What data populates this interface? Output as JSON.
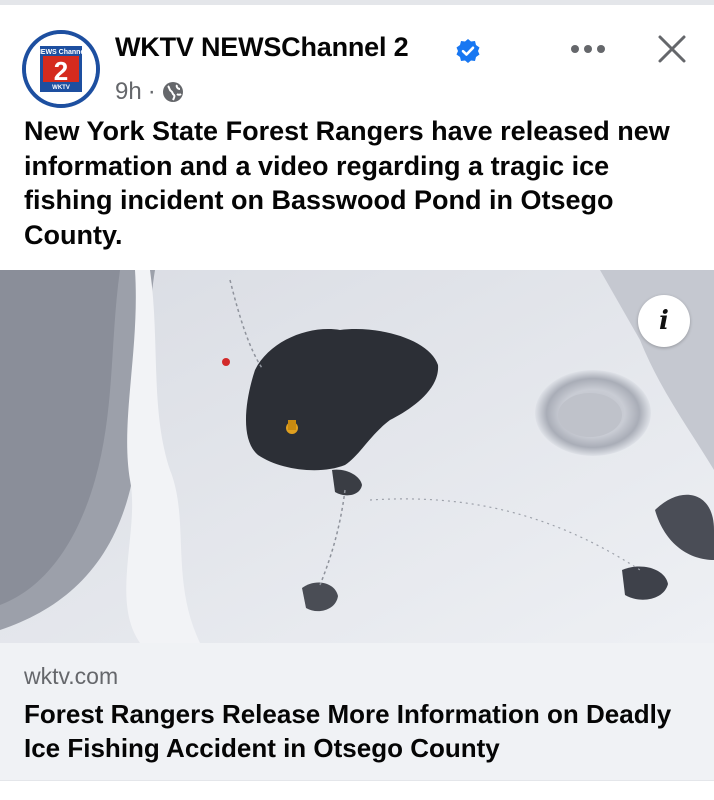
{
  "post": {
    "page_name": "WKTV NEWSChannel 2",
    "verified_icon": "verified-badge-icon",
    "time_ago": "9h",
    "separator": "·",
    "audience_icon": "globe-icon",
    "text": "New York State Forest Rangers have released new information and a video regarding a tragic ice fishing incident on Basswood Pond in Otsego County."
  },
  "logo": {
    "top_text": "NEWS Channel",
    "numeral": "2",
    "bottom_text": "WKTV"
  },
  "actions": {
    "more_icon": "more-options-icon",
    "close_icon": "close-icon",
    "info_label": "i"
  },
  "link_preview": {
    "domain": "wktv.com",
    "title": "Forest Rangers Release More Information on Deadly Ice Fishing Accident in Otsego County"
  },
  "colors": {
    "verified_blue": "#1877f2",
    "secondary_text": "#65676b",
    "preview_bg": "#f0f2f5",
    "logo_blue": "#1d4fa0",
    "logo_red": "#d52b1e"
  }
}
